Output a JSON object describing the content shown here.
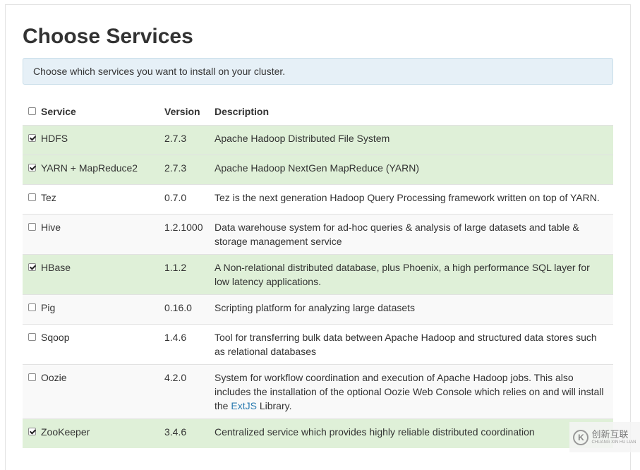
{
  "page": {
    "title": "Choose Services",
    "alert": "Choose which services you want to install on your cluster."
  },
  "table": {
    "headers": {
      "service": "Service",
      "version": "Version",
      "description": "Description"
    },
    "rows": [
      {
        "service": "HDFS",
        "version": "2.7.3",
        "checked": true,
        "description": "Apache Hadoop Distributed File System"
      },
      {
        "service": "YARN + MapReduce2",
        "version": "2.7.3",
        "checked": true,
        "description": "Apache Hadoop NextGen MapReduce (YARN)"
      },
      {
        "service": "Tez",
        "version": "0.7.0",
        "checked": false,
        "description": "Tez is the next generation Hadoop Query Processing framework written on top of YARN."
      },
      {
        "service": "Hive",
        "version": "1.2.1000",
        "checked": false,
        "description": "Data warehouse system for ad-hoc queries & analysis of large datasets and table & storage management service"
      },
      {
        "service": "HBase",
        "version": "1.1.2",
        "checked": true,
        "description": "A Non-relational distributed database, plus Phoenix, a high performance SQL layer for low latency applications."
      },
      {
        "service": "Pig",
        "version": "0.16.0",
        "checked": false,
        "description": "Scripting platform for analyzing large datasets"
      },
      {
        "service": "Sqoop",
        "version": "1.4.6",
        "checked": false,
        "description": "Tool for transferring bulk data between Apache Hadoop and structured data stores such as relational databases"
      },
      {
        "service": "Oozie",
        "version": "4.2.0",
        "checked": false,
        "description_pre": "System for workflow coordination and execution of Apache Hadoop jobs. This also includes the installation of the optional Oozie Web Console which relies on and will install the ",
        "description_link": "ExtJS",
        "description_post": " Library."
      },
      {
        "service": "ZooKeeper",
        "version": "3.4.6",
        "checked": true,
        "description": "Centralized service which provides highly reliable distributed coordination"
      }
    ]
  },
  "watermark": {
    "text": "创新互联",
    "sub": "CHUANG XIN HU LIAN"
  },
  "colors": {
    "selected_row": "#dff0d8",
    "alt_row": "#f9f9f9",
    "alert_bg": "#e6f0f7",
    "link": "#2a7ab0"
  }
}
